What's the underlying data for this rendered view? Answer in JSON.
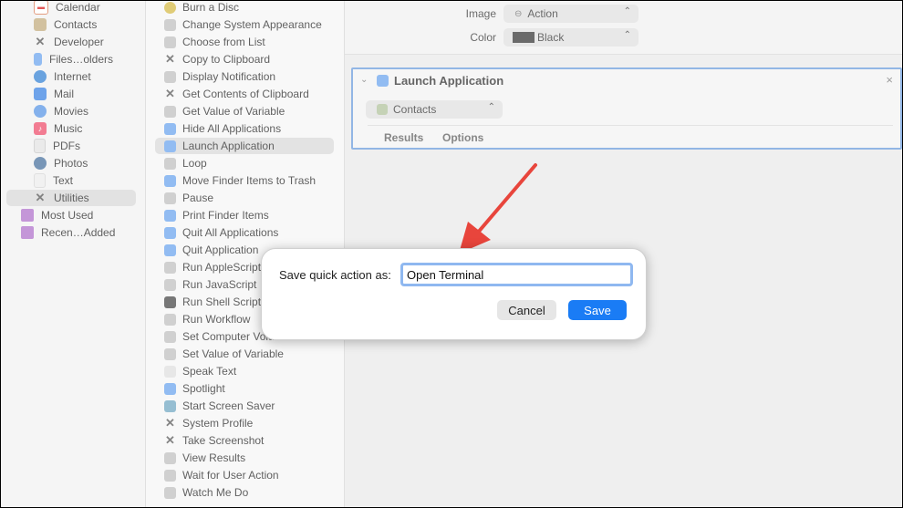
{
  "library": {
    "items": [
      {
        "label": "Calendar",
        "icon": "calendar-icon"
      },
      {
        "label": "Contacts",
        "icon": "contacts-icon"
      },
      {
        "label": "Developer",
        "icon": "tools-icon"
      },
      {
        "label": "Files…olders",
        "icon": "finder-icon"
      },
      {
        "label": "Internet",
        "icon": "globe-icon"
      },
      {
        "label": "Mail",
        "icon": "mail-icon"
      },
      {
        "label": "Movies",
        "icon": "movies-icon"
      },
      {
        "label": "Music",
        "icon": "music-icon"
      },
      {
        "label": "PDFs",
        "icon": "pdf-icon"
      },
      {
        "label": "Photos",
        "icon": "photos-icon"
      },
      {
        "label": "Text",
        "icon": "text-icon"
      },
      {
        "label": "Utilities",
        "icon": "tools-icon"
      }
    ],
    "folders": [
      {
        "label": "Most Used",
        "icon": "folder-icon"
      },
      {
        "label": "Recen…Added",
        "icon": "folder-icon"
      }
    ],
    "selected": "Utilities"
  },
  "actions": {
    "items": [
      "Burn a Disc",
      "Change System Appearance",
      "Choose from List",
      "Copy to Clipboard",
      "Display Notification",
      "Get Contents of Clipboard",
      "Get Value of Variable",
      "Hide All Applications",
      "Launch Application",
      "Loop",
      "Move Finder Items to Trash",
      "Pause",
      "Print Finder Items",
      "Quit All Applications",
      "Quit Application",
      "Run AppleScript",
      "Run JavaScript",
      "Run Shell Script",
      "Run Workflow",
      "Set Computer Volume",
      "Set Value of Variable",
      "Speak Text",
      "Spotlight",
      "Start Screen Saver",
      "System Profile",
      "Take Screenshot",
      "View Results",
      "Wait for User Action",
      "Watch Me Do"
    ],
    "selected": "Launch Application"
  },
  "workflow_options": {
    "image_label": "Image",
    "image_value": "Action",
    "color_label": "Color",
    "color_value": "Black",
    "color_swatch": "#4a4a4a"
  },
  "action_card": {
    "title": "Launch Application",
    "app_value": "Contacts",
    "tabs": [
      "Results",
      "Options"
    ],
    "close_glyph": "×"
  },
  "dialog": {
    "label": "Save quick action as:",
    "input_value": "Open Terminal",
    "cancel_label": "Cancel",
    "save_label": "Save"
  },
  "colors": {
    "accent": "#1a7cf5",
    "annotation_arrow": "#e8453c"
  }
}
